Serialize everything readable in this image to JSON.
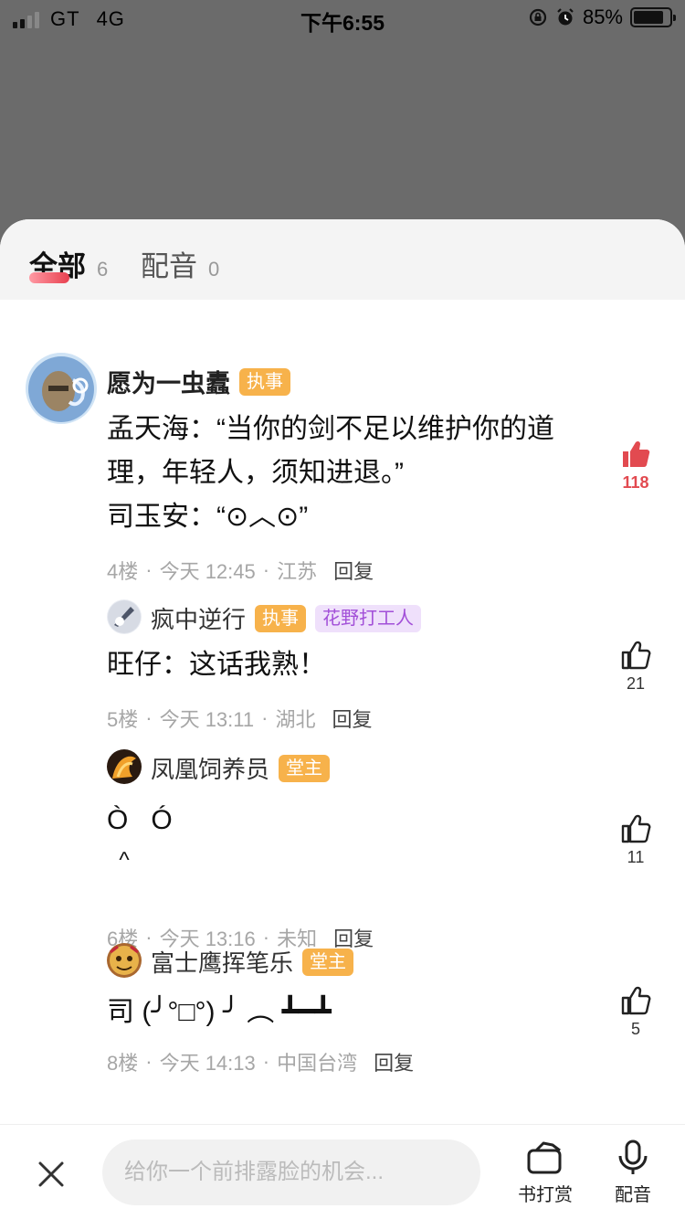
{
  "status_bar": {
    "carrier": "GT",
    "network": "4G",
    "time": "下午6:55",
    "battery_percent": "85%",
    "battery_level": 0.85
  },
  "tabs": [
    {
      "label": "全部",
      "count": "6",
      "active": true
    },
    {
      "label": "配音",
      "count": "0",
      "active": false
    }
  ],
  "comments": [
    {
      "username": "愿为一虫蠹",
      "badges": [
        "执事"
      ],
      "lines": [
        "孟天海：“当你的剑不足以维护你的道",
        "理，年轻人，须知进退。”",
        "司玉安：“⊙︿⊙”"
      ],
      "floor": "4楼",
      "time": "今天 12:45",
      "location": "江苏",
      "reply_label": "回复",
      "likes": "118",
      "liked": true
    },
    {
      "username": "疯中逆行",
      "badges": [
        "执事",
        "花野打工人"
      ],
      "lines": [
        "旺仔：这话我熟！"
      ],
      "floor": "5楼",
      "time": "今天 13:11",
      "location": "湖北",
      "reply_label": "回复",
      "likes": "21",
      "liked": false
    },
    {
      "username": "凤凰饲养员",
      "badges": [
        "堂主"
      ],
      "lines": [
        "Ò   Ó",
        "  ^"
      ],
      "floor": "6楼",
      "time": "今天 13:16",
      "location": "未知",
      "reply_label": "回复",
      "likes": "11",
      "liked": false
    },
    {
      "username": "富士鹰挥笔乐",
      "badges": [
        "堂主"
      ],
      "lines": [
        "司 (╯°□°) ╯ ︵ ┻━┻"
      ],
      "floor": "8楼",
      "time": "今天 14:13",
      "location": "中国台湾",
      "reply_label": "回复",
      "likes": "5",
      "liked": false
    }
  ],
  "meta_separator": "·",
  "bottom_bar": {
    "input_placeholder": "给你一个前排露脸的机会...",
    "reward_label": "书打赏",
    "dub_label": "配音"
  },
  "colors": {
    "accent_red": "#e24a50",
    "badge_orange": "#f7b24b",
    "badge_purple_bg": "#efe0fb",
    "badge_purple_text": "#a24fd8"
  }
}
